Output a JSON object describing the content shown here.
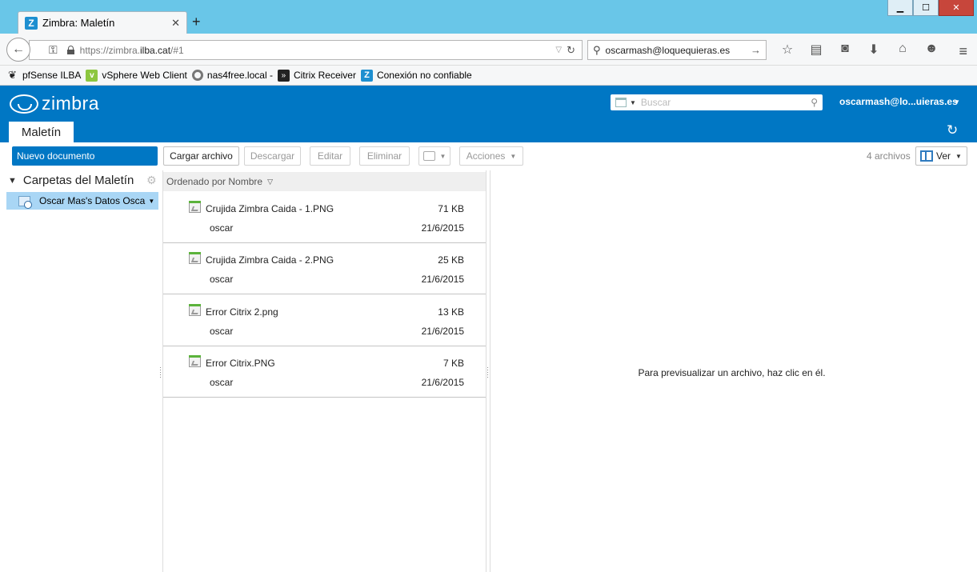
{
  "browser": {
    "tab_title": "Zimbra: Maletín",
    "tab_favicon": "Z",
    "url_prefix": "https://zimbra.",
    "url_host": "ilba.cat",
    "url_suffix": "/#1",
    "search_value": "oscarmash@loquequieras.es",
    "bookmarks": [
      {
        "label": "pfSense ILBA",
        "icon": "pfsense-icon"
      },
      {
        "label": "vSphere Web Client",
        "icon": "vsphere-icon"
      },
      {
        "label": "nas4free.local -",
        "icon": "nas4free-icon"
      },
      {
        "label": "Citrix Receiver",
        "icon": "citrix-icon"
      },
      {
        "label": "Conexión no confiable",
        "icon": "zimbra-icon"
      }
    ]
  },
  "zimbra": {
    "logo": "zimbra",
    "search_placeholder": "Buscar",
    "user": "oscarmash@lo...uieras.es",
    "app_tab": "Maletín"
  },
  "toolbar": {
    "new_document": "Nuevo documento",
    "upload": "Cargar archivo",
    "download": "Descargar",
    "edit": "Editar",
    "delete": "Eliminar",
    "actions": "Acciones",
    "file_count": "4 archivos",
    "view": "Ver"
  },
  "sidebar": {
    "header": "Carpetas del Maletín",
    "folder": "Oscar Mas's Datos Osca"
  },
  "list": {
    "sort_label": "Ordenado por Nombre",
    "files": [
      {
        "name": "Crujida Zimbra Caida - 1.PNG",
        "size": "71 KB",
        "owner": "oscar",
        "date": "21/6/2015"
      },
      {
        "name": "Crujida Zimbra Caida - 2.PNG",
        "size": "25 KB",
        "owner": "oscar",
        "date": "21/6/2015"
      },
      {
        "name": "Error Citrix 2.png",
        "size": "13 KB",
        "owner": "oscar",
        "date": "21/6/2015"
      },
      {
        "name": "Error Citrix.PNG",
        "size": "7 KB",
        "owner": "oscar",
        "date": "21/6/2015"
      }
    ]
  },
  "preview": {
    "message": "Para previsualizar un archivo, haz clic en él."
  },
  "colors": {
    "brand_blue": "#0077c4",
    "tabbar": "#69c6e8",
    "selected_folder": "#a9d6f5"
  }
}
